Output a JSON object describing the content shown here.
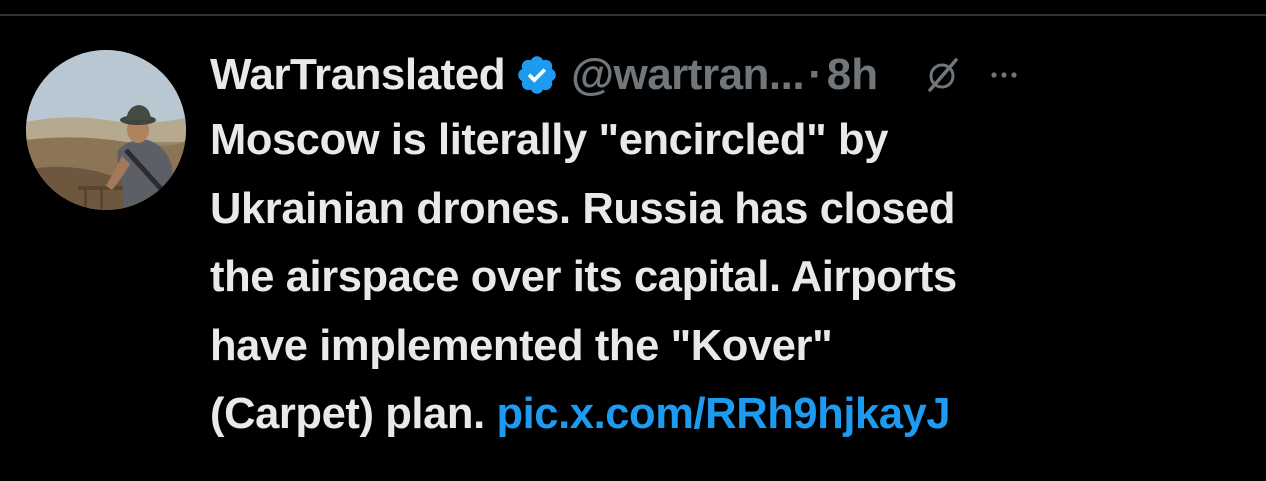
{
  "tweet": {
    "display_name": "WarTranslated",
    "handle": "@wartran...",
    "separator": "·",
    "timestamp": "8h",
    "lines": [
      "Moscow is literally \"encircled\" by",
      "Ukrainian drones. Russia has closed",
      "the airspace over its capital. Airports",
      "have implemented the \"Kover\""
    ],
    "last_line_text": "(Carpet) plan. ",
    "link_text": "pic.x.com/RRh9hjkayJ"
  },
  "icons": {
    "verified": "verified-badge-icon",
    "grok": "grok-icon",
    "more": "more-options-icon"
  },
  "colors": {
    "background": "#000000",
    "text": "#e7e9ea",
    "muted": "#71767b",
    "link": "#1d9bf0",
    "verified": "#1d9bf0"
  }
}
